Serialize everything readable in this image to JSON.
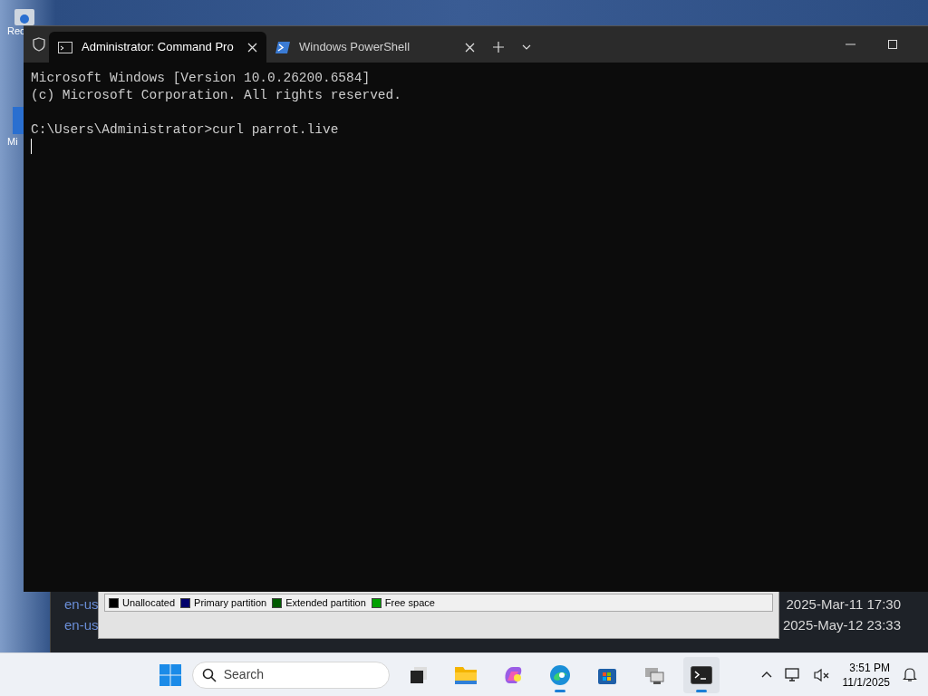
{
  "desktop": {
    "icons": [
      {
        "label": "Rec"
      },
      {
        "label": "Mi"
      }
    ]
  },
  "file_list": {
    "rows": [
      {
        "name": "en-us",
        "date": "2025-Mar-11 17:30"
      },
      {
        "name": "en-us",
        "date": "2025-May-12 23:33"
      }
    ]
  },
  "legend": {
    "items": [
      {
        "label": "Unallocated",
        "color": "#000000"
      },
      {
        "label": "Primary partition",
        "color": "#00006b"
      },
      {
        "label": "Extended partition",
        "color": "#005a00"
      },
      {
        "label": "Free space",
        "color": "#00a000"
      }
    ]
  },
  "terminal": {
    "tabs": [
      {
        "title": "Administrator: Command Pro",
        "kind": "cmd",
        "selected": true
      },
      {
        "title": "Windows PowerShell",
        "kind": "powershell",
        "selected": false
      }
    ],
    "blocks": [
      [
        "Microsoft Windows [Version 10.0.26200.6584]",
        "(c) Microsoft Corporation. All rights reserved."
      ],
      [
        "C:\\Users\\Administrator>curl parrot.live"
      ]
    ]
  },
  "taskbar": {
    "search": {
      "placeholder": "Search"
    },
    "apps": [
      {
        "kind": "taskview",
        "active": false
      },
      {
        "kind": "explorer",
        "active": false
      },
      {
        "kind": "copilot",
        "active": false
      },
      {
        "kind": "edge",
        "active": true
      },
      {
        "kind": "store",
        "active": false
      },
      {
        "kind": "vm",
        "active": false
      },
      {
        "kind": "terminal",
        "active": true
      }
    ],
    "time": "3:51 PM",
    "date": "11/1/2025"
  }
}
